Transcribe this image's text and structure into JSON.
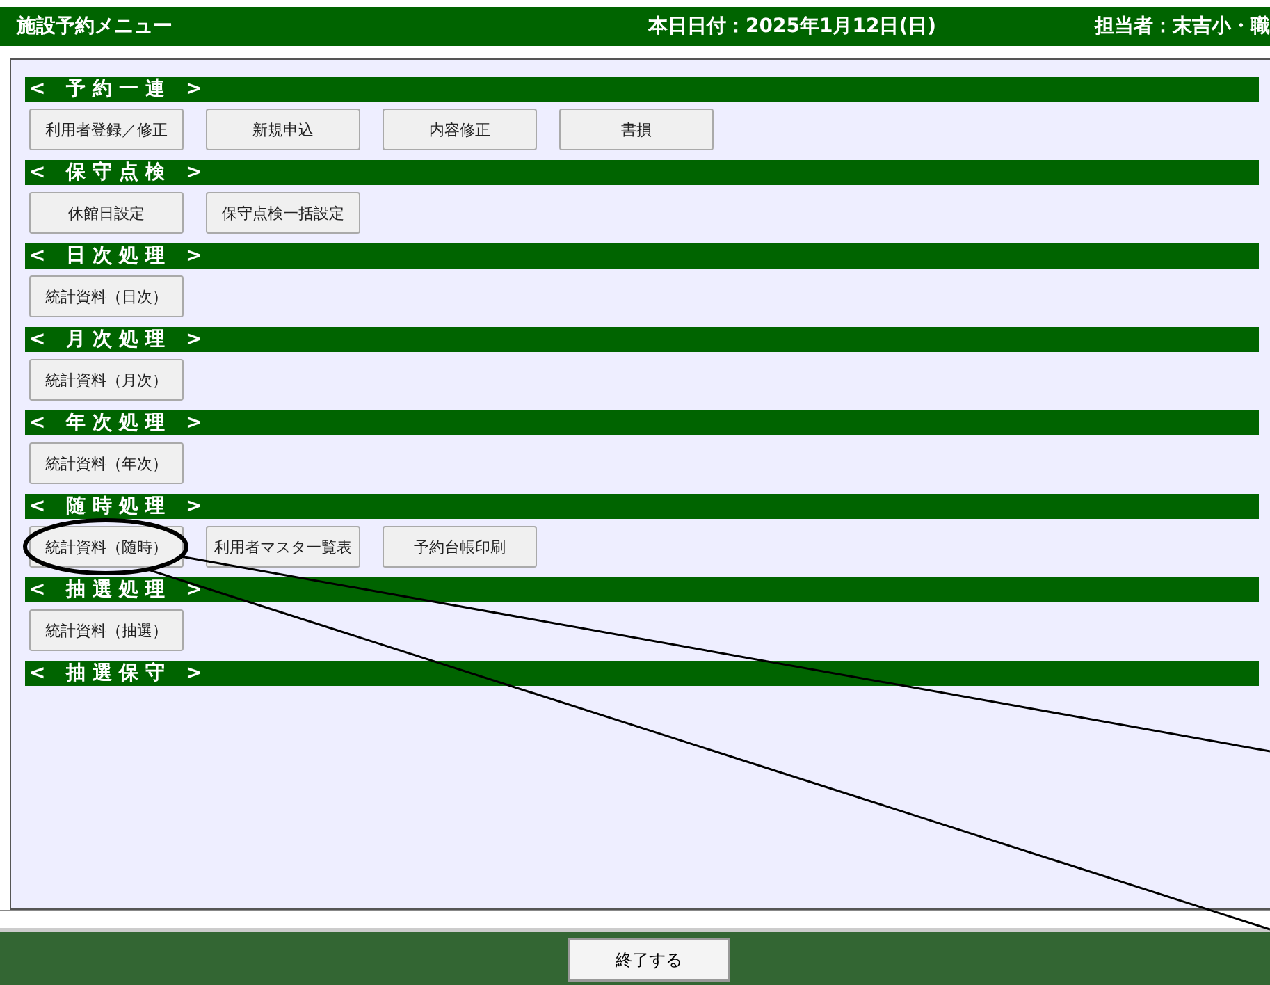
{
  "header": {
    "title": "施設予約メニュー",
    "date": "本日日付：2025年1月12日(日)",
    "user": "担当者：末吉小・職"
  },
  "sections": [
    {
      "title": "< 予約一連 >",
      "buttons": [
        "利用者登録／修正",
        "新規申込",
        "内容修正",
        "書損"
      ]
    },
    {
      "title": "< 保守点検 >",
      "buttons": [
        "休館日設定",
        "保守点検一括設定"
      ]
    },
    {
      "title": "< 日次処理 >",
      "buttons": [
        "統計資料（日次）"
      ]
    },
    {
      "title": "< 月次処理 >",
      "buttons": [
        "統計資料（月次）"
      ]
    },
    {
      "title": "< 年次処理 >",
      "buttons": [
        "統計資料（年次）"
      ]
    },
    {
      "title": "< 随時処理 >",
      "buttons": [
        "統計資料（随時）",
        "利用者マスタ一覧表",
        "予約台帳印刷"
      ]
    },
    {
      "title": "< 抽選処理 >",
      "buttons": [
        "統計資料（抽選）"
      ]
    },
    {
      "title": "< 抽選保守 >"
    }
  ],
  "footer": {
    "button": "終了する"
  }
}
